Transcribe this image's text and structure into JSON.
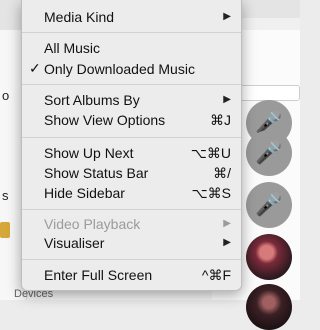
{
  "menu": {
    "groups": [
      [
        {
          "label": "Media Kind",
          "submenu": true
        }
      ],
      [
        {
          "label": "All Music"
        },
        {
          "label": "Only Downloaded Music",
          "checked": true
        }
      ],
      [
        {
          "label": "Sort Albums By",
          "submenu": true
        },
        {
          "label": "Show View Options",
          "shortcut": "⌘J"
        }
      ],
      [
        {
          "label": "Show Up Next",
          "shortcut": "⌥⌘U"
        },
        {
          "label": "Show Status Bar",
          "shortcut": "⌘/"
        },
        {
          "label": "Hide Sidebar",
          "shortcut": "⌥⌘S"
        }
      ],
      [
        {
          "label": "Video Playback",
          "submenu": true,
          "disabled": true
        },
        {
          "label": "Visualiser",
          "submenu": true
        }
      ],
      [
        {
          "label": "Enter Full Screen",
          "shortcut": "^⌘F"
        }
      ]
    ],
    "check_glyph": "✓",
    "submenu_arrow": "▶"
  },
  "background": {
    "sidebar_fragment_1": "o",
    "sidebar_fragment_2": "s",
    "sidebar_section": "Devices",
    "artist_icon": "microphone-icon"
  }
}
